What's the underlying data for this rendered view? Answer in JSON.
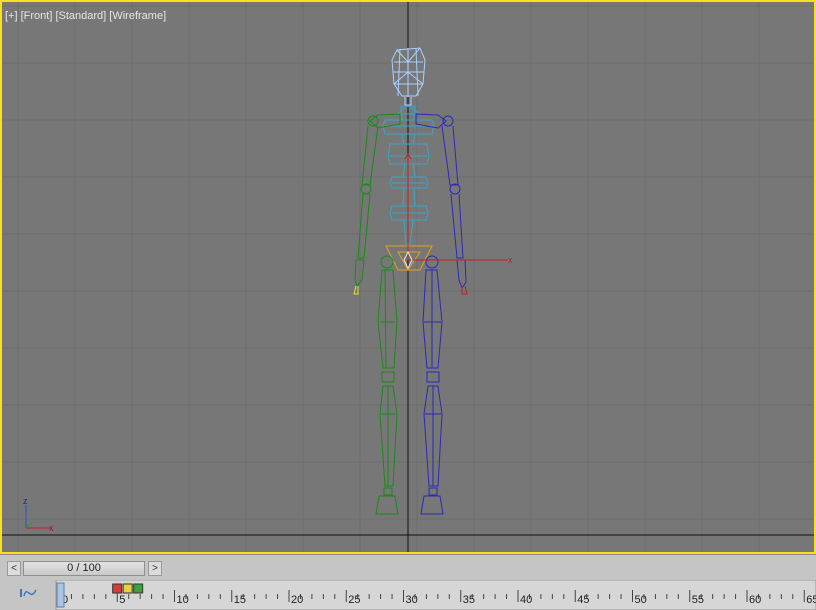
{
  "viewport": {
    "label_parts": [
      "[+]",
      "[Front]",
      "[Standard]",
      "[Wireframe]"
    ],
    "active_border_color": "#f5e11e",
    "background_color": "#777777",
    "axis_gizmo": {
      "z_label": "z",
      "x_label": "x"
    },
    "transform_gizmo": {
      "x_label": "x"
    },
    "biped_colors": {
      "left": "#1a8a1a",
      "right": "#2a2ab8",
      "center": "#3aa6c8",
      "head": "#a8d0ff",
      "root": "#e0a020"
    }
  },
  "timeline": {
    "prev_arrow": "<",
    "next_arrow": ">",
    "slider_text": "0 / 100",
    "current_frame": 0,
    "total_frames": 100,
    "ruler_ticks": [
      "0",
      "5",
      "10",
      "15",
      "20",
      "25",
      "30",
      "35",
      "40",
      "45",
      "50",
      "55",
      "60",
      "65"
    ],
    "curve_icon": "mini-curve-editor-icon",
    "key_colors": [
      "#d43c3c",
      "#e6d23c",
      "#3ca03c"
    ]
  }
}
